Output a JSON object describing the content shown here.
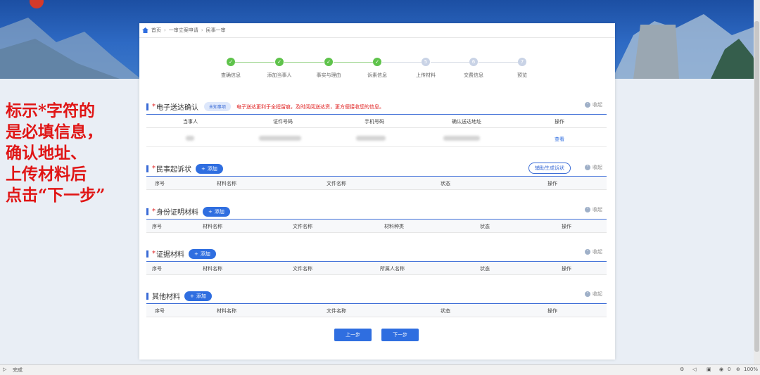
{
  "overlay_note": [
    "标示*字符的",
    "是必填信息，",
    "确认地址、",
    "上传材料后",
    "点击“下一步”"
  ],
  "breadcrumb": [
    "首页",
    "一审立案申请",
    "民事一审"
  ],
  "steps": [
    {
      "label": "查确信息",
      "state": "done",
      "mark": "✓"
    },
    {
      "label": "添加当事人",
      "state": "done",
      "mark": "✓"
    },
    {
      "label": "事实与理由",
      "state": "done",
      "mark": "✓"
    },
    {
      "label": "诉素信息",
      "state": "done",
      "mark": "✓"
    },
    {
      "label": "上传材料",
      "state": "todo",
      "mark": "5"
    },
    {
      "label": "交费信息",
      "state": "todo",
      "mark": "6"
    },
    {
      "label": "预览",
      "state": "todo",
      "mark": "7"
    }
  ],
  "collapse_label": "收起",
  "add_label": "添加",
  "sections": {
    "delivery": {
      "title": "电子送达确认",
      "tag": "未知事项",
      "notice": "电子送达更利于全程留痕，及时阅阅送达资，更方便接收您的信息。",
      "columns": [
        "当事人",
        "证件号码",
        "手机号码",
        "确认送达地址",
        "操作"
      ],
      "row_action": "查看"
    },
    "complaint": {
      "title": "民事起诉状",
      "assist": "辅助生成诉状",
      "columns": [
        "序号",
        "材料名称",
        "文件名称",
        "状态",
        "操作"
      ]
    },
    "identity": {
      "title": "身份证明材料",
      "columns": [
        "序号",
        "材料名称",
        "文件名称",
        "材料种类",
        "状态",
        "操作"
      ]
    },
    "evidence": {
      "title": "证据材料",
      "columns": [
        "序号",
        "材料名称",
        "文件名称",
        "所属人名称",
        "状态",
        "操作"
      ]
    },
    "other": {
      "title": "其他材料",
      "columns": [
        "序号",
        "材料名称",
        "文件名称",
        "状态",
        "操作"
      ]
    }
  },
  "buttons": {
    "prev": "上一步",
    "next": "下一步"
  },
  "status": {
    "left": "完成",
    "zoom": "100%",
    "count": "0"
  },
  "colors": {
    "primary": "#2f6ee0",
    "required": "#e02020",
    "done": "#5fc34b"
  }
}
